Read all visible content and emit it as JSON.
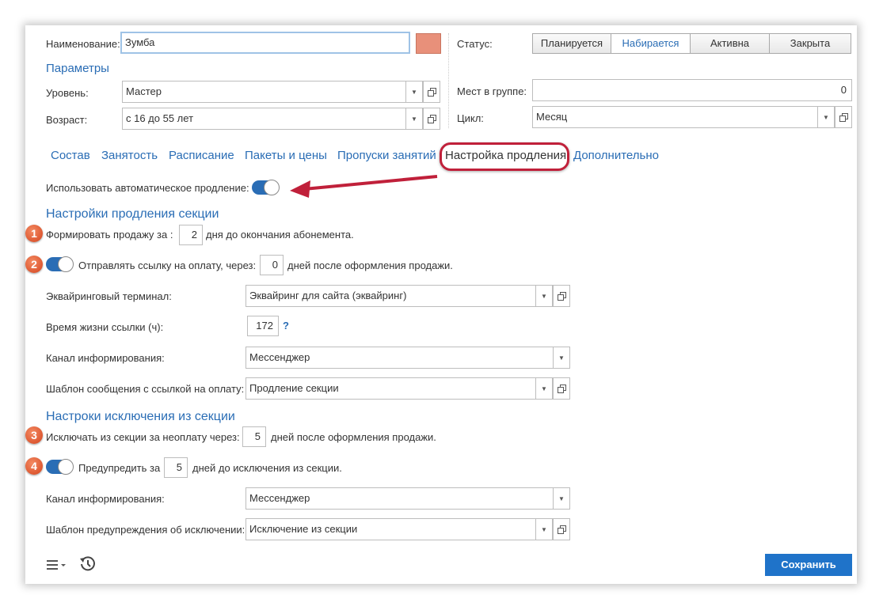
{
  "form": {
    "name_label": "Наименование:",
    "name_value": "Зумба",
    "params_title": "Параметры",
    "level_label": "Уровень:",
    "level_value": "Мастер",
    "age_label": "Возраст:",
    "age_value": "с 16 до 55 лет",
    "status_label": "Статус:",
    "status_options": [
      "Планируется",
      "Набирается",
      "Активна",
      "Закрыта"
    ],
    "status_selected": "Набирается",
    "places_label": "Мест в группе:",
    "places_value": "0",
    "cycle_label": "Цикл:",
    "cycle_value": "Месяц",
    "color_swatch": "#e8907a"
  },
  "tabs": [
    "Состав",
    "Занятость",
    "Расписание",
    "Пакеты и цены",
    "Пропуски занятий",
    "Настройка продления",
    "Дополнительно"
  ],
  "active_tab": "Настройка продления",
  "auto_renew": {
    "label": "Использовать автоматическое продление:",
    "on": true
  },
  "renew_section": {
    "title": "Настройки продления секции",
    "form_sale_prefix": "Формировать продажу за :",
    "form_sale_value": "2",
    "form_sale_suffix": "дня до окончания абонемента.",
    "send_link_prefix": "Отправлять ссылку на оплату, через:",
    "send_link_value": "0",
    "send_link_suffix": "дней после оформления продажи.",
    "terminal_label": "Эквайринговый терминал:",
    "terminal_value": "Эквайринг для сайта (эквайринг)",
    "link_life_label": "Время жизни ссылки (ч):",
    "link_life_value": "172",
    "help_mark": "?",
    "channel_label": "Канал информирования:",
    "channel_value": "Мессенджер",
    "template_label": "Шаблон сообщения с ссылкой на оплату:",
    "template_value": "Продление секции"
  },
  "exclude_section": {
    "title": "Настроки исключения из секции",
    "exclude_prefix": "Исключать из секции за неоплату через:",
    "exclude_value": "5",
    "exclude_suffix": "дней после оформления продажи.",
    "warn_prefix": "Предупредить за",
    "warn_value": "5",
    "warn_suffix": "дней до исключения из секции.",
    "channel_label": "Канал информирования:",
    "channel_value": "Мессенджер",
    "template_label": "Шаблон предупреждения об исключении:",
    "template_value": "Исключение из секции"
  },
  "badges": [
    "1",
    "2",
    "3",
    "4"
  ],
  "footer": {
    "save_label": "Сохранить"
  },
  "colors": {
    "accent": "#2a6db5",
    "save": "#1f73c9",
    "highlight": "#c0203a",
    "badge": "#e0552e"
  }
}
